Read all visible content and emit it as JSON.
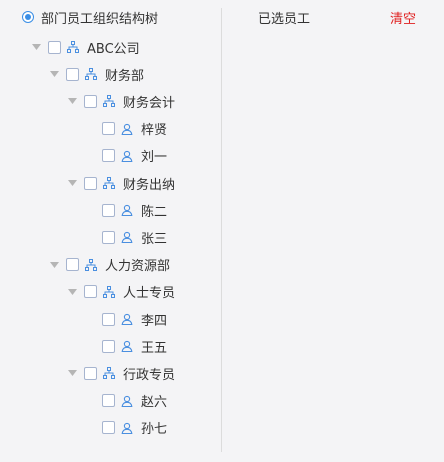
{
  "left": {
    "header_label": "部门员工组织结构树"
  },
  "right": {
    "title": "已选员工",
    "clear_label": "清空"
  },
  "tree": [
    {
      "label": "ABC公司",
      "type": "dept",
      "expanded": true,
      "level": 0
    },
    {
      "label": "财务部",
      "type": "dept",
      "expanded": true,
      "level": 1
    },
    {
      "label": "财务会计",
      "type": "dept",
      "expanded": true,
      "level": 2
    },
    {
      "label": "梓贤",
      "type": "user",
      "level": 3
    },
    {
      "label": "刘一",
      "type": "user",
      "level": 3
    },
    {
      "label": "财务出纳",
      "type": "dept",
      "expanded": true,
      "level": 2
    },
    {
      "label": "陈二",
      "type": "user",
      "level": 3
    },
    {
      "label": "张三",
      "type": "user",
      "level": 3
    },
    {
      "label": "人力资源部",
      "type": "dept",
      "expanded": true,
      "level": 1
    },
    {
      "label": "人士专员",
      "type": "dept",
      "expanded": true,
      "level": 2
    },
    {
      "label": "李四",
      "type": "user",
      "level": 3
    },
    {
      "label": "王五",
      "type": "user",
      "level": 3
    },
    {
      "label": "行政专员",
      "type": "dept",
      "expanded": true,
      "level": 2
    },
    {
      "label": "赵六",
      "type": "user",
      "level": 3
    },
    {
      "label": "孙七",
      "type": "user",
      "level": 3
    }
  ],
  "colors": {
    "accent": "#3a8ee6",
    "clear": "#e02020",
    "icon": "#4a8fe0"
  },
  "icons": {
    "dept": "org-structure-icon",
    "user": "user-icon",
    "arrow": "caret-down-icon"
  }
}
